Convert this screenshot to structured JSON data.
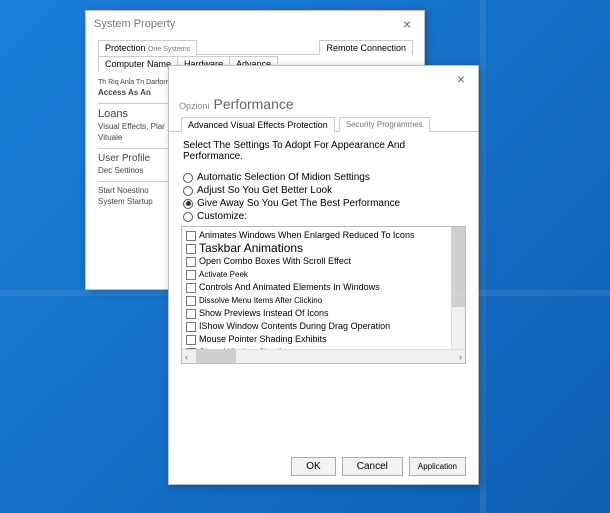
{
  "win1": {
    "title": "System Property",
    "tabsTop": [
      "Protection",
      "One Systems",
      "Remote Connection"
    ],
    "tabsBottom": [
      "Computer Name",
      "Hardware",
      "Advance"
    ],
    "subheading1": "Th Riq Anla Tn Darform",
    "subheading2": "Access As An",
    "section1": "Loans",
    "section1_line1": "Visual Effects, Plar",
    "section1_line2": "Vituale",
    "section2": "User Profile",
    "section2_line": "Dec Settinos",
    "section3_line1": "Start Noestino",
    "section3_line2": "System Startup"
  },
  "win2": {
    "titlePre": "Opzioni",
    "titleMain": "Performance",
    "tabMain": "Advanced Visual Effects Protection",
    "tabSec": "Security Programmes",
    "instruction": "Select The Settings To Adopt For Appearance And Performance.",
    "radios": [
      {
        "label": "Automatic Selection Of Midion Settings",
        "selected": false
      },
      {
        "label": "Adjust So You Get Better Look",
        "selected": false
      },
      {
        "label": "Give Away So You Get The Best Performance",
        "selected": true
      },
      {
        "label": "Customize:",
        "selected": false
      }
    ],
    "items": [
      "Animates Windows When Enlarged Reduced To Icons",
      "Taskbar Animations",
      "Open Combo Boxes With Scroll Effect",
      "Activate Peek",
      "Controls And Animated Elements In Windows",
      "Dissolve Menu Items After Clickino",
      "Show Previews Instead Of Icons",
      "IShow Window Contents During Drag Operation",
      "Mouse Pointer Shading Exhibits",
      "Show Window Shading"
    ],
    "buttons": {
      "ok": "OK",
      "cancel": "Cancel",
      "apply": "Application"
    }
  }
}
